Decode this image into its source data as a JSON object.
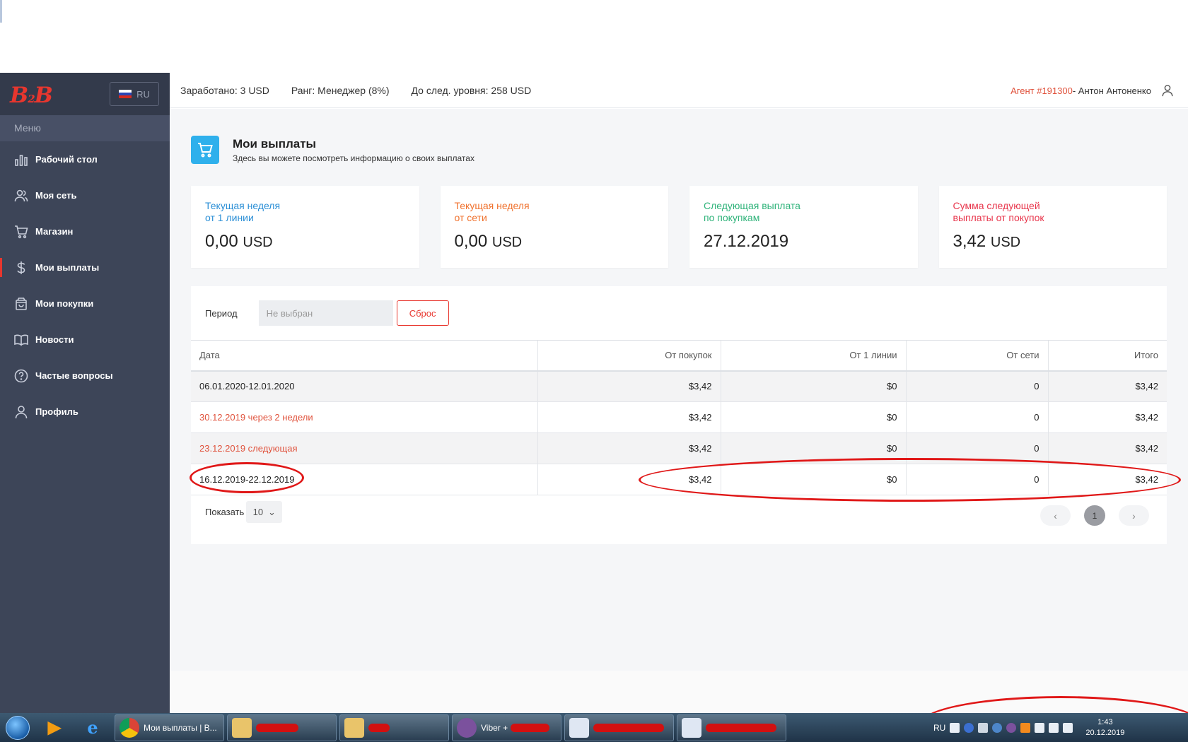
{
  "sidebar": {
    "logo_text": "B2B",
    "lang": "RU",
    "menu_label": "Меню",
    "items": [
      {
        "label": "Рабочий стол",
        "icon": "bar-chart-icon"
      },
      {
        "label": "Моя сеть",
        "icon": "users-icon"
      },
      {
        "label": "Магазин",
        "icon": "cart-icon"
      },
      {
        "label": "Мои выплаты",
        "icon": "dollar-icon",
        "active": true
      },
      {
        "label": "Мои покупки",
        "icon": "bag-icon"
      },
      {
        "label": "Новости",
        "icon": "book-icon"
      },
      {
        "label": "Частые вопросы",
        "icon": "question-icon"
      },
      {
        "label": "Профиль",
        "icon": "user-icon"
      }
    ]
  },
  "header": {
    "earned": "Заработано: 3 USD",
    "rank": "Ранг: Менеджер (8%)",
    "next_level": "До след. уровня: 258 USD",
    "agent": "Агент #191300",
    "agent_name": " - Антон Антоненко"
  },
  "page": {
    "title": "Мои выплаты",
    "subtitle": "Здесь вы можете посмотреть информацию о своих выплатах"
  },
  "cards": [
    {
      "label": "Текущая неделя\nот 1 линии",
      "value": "0,00",
      "unit": "USD",
      "color": "#2b8fd6"
    },
    {
      "label": "Текущая неделя\nот сети",
      "value": "0,00",
      "unit": "USD",
      "color": "#f0722e"
    },
    {
      "label": "Следующая выплата\nпо покупкам",
      "value": "27.12.2019",
      "unit": "",
      "color": "#2fb37a"
    },
    {
      "label": "Сумма следующей\nвыплаты от покупок",
      "value": "3,42",
      "unit": "USD",
      "color": "#e8364c"
    }
  ],
  "filter": {
    "label": "Период",
    "placeholder": "Не выбран",
    "reset": "Сброс"
  },
  "table": {
    "headers": [
      "Дата",
      "От покупок",
      "От 1 линии",
      "От сети",
      "Итого"
    ],
    "rows": [
      {
        "date": "06.01.2020-12.01.2020",
        "purchases": "$3,42",
        "line1": "$0",
        "network": "0",
        "total": "$3,42",
        "highlight": false
      },
      {
        "date": "30.12.2019 через 2 недели",
        "purchases": "$3,42",
        "line1": "$0",
        "network": "0",
        "total": "$3,42",
        "highlight": true
      },
      {
        "date": "23.12.2019 следующая",
        "purchases": "$3,42",
        "line1": "$0",
        "network": "0",
        "total": "$3,42",
        "highlight": true
      },
      {
        "date": "16.12.2019-22.12.2019",
        "purchases": "$3,42",
        "line1": "$0",
        "network": "0",
        "total": "$3,42",
        "highlight": false
      }
    ]
  },
  "pagination": {
    "show_label": "Показать",
    "page_size": "10",
    "prev": "‹",
    "current": "1",
    "next": "›"
  },
  "taskbar": {
    "chrome_label": "Мои выплаты | B...",
    "viber_label": "Viber +",
    "tray_lang": "RU",
    "time": "1:43",
    "date": "20.12.2019"
  }
}
